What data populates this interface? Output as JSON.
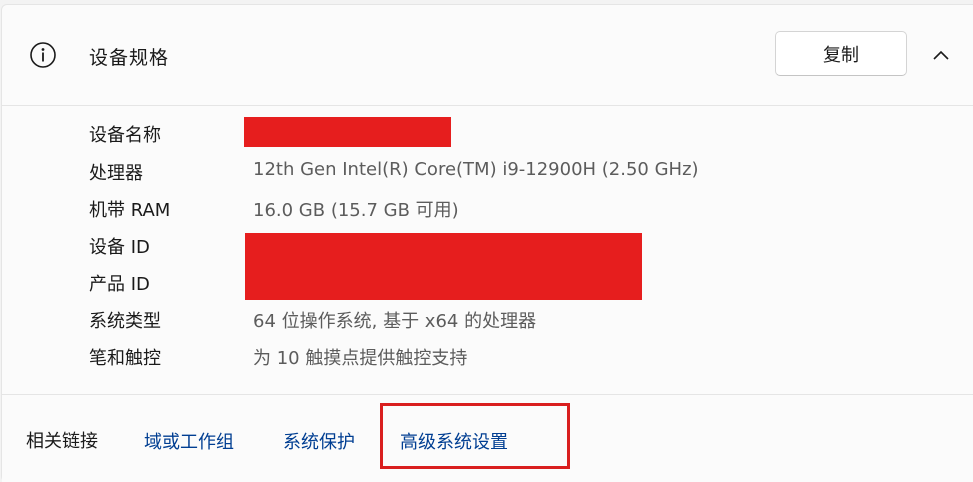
{
  "header": {
    "title": "设备规格",
    "copy_label": "复制"
  },
  "specs": [
    {
      "label": "设备名称",
      "value": ""
    },
    {
      "label": "处理器",
      "value": "12th Gen Intel(R) Core(TM) i9-12900H (2.50 GHz)"
    },
    {
      "label": "机带 RAM",
      "value": "16.0 GB (15.7 GB 可用)"
    },
    {
      "label": "设备 ID",
      "value": ""
    },
    {
      "label": "产品 ID",
      "value": ""
    },
    {
      "label": "系统类型",
      "value": "64 位操作系统, 基于 x64 的处理器"
    },
    {
      "label": "笔和触控",
      "value": "为 10 触摸点提供触控支持"
    }
  ],
  "related": {
    "label": "相关链接",
    "links": [
      "域或工作组",
      "系统保护",
      "高级系统设置"
    ]
  },
  "colors": {
    "redaction": "#e61e1e",
    "link": "#003e92",
    "highlight": "#d91e1e"
  }
}
